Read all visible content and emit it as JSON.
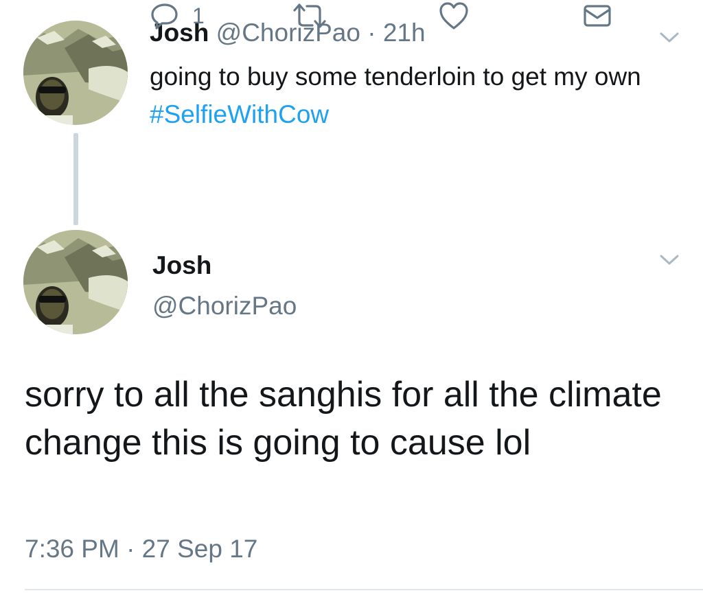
{
  "thread": {
    "parent_tweet": {
      "author_name": "Josh",
      "author_handle": "@ChorizPao",
      "separator": "·",
      "relative_time": "21h",
      "text_prefix": "going to buy some tenderloin to get my own ",
      "hashtag": "#SelfieWithCow",
      "reply_count": "1",
      "icons": [
        "chevron-down-icon",
        "reply-icon",
        "retweet-icon",
        "like-icon",
        "direct-message-icon"
      ]
    },
    "main_tweet": {
      "author_name": "Josh",
      "author_handle": "@ChorizPao",
      "text": "sorry to all the sanghis for all the climate change this is going to cause lol",
      "timestamp": "7:36 PM · 27 Sep 17",
      "icons": [
        "chevron-down-icon"
      ]
    }
  },
  "colors": {
    "text": "#14171a",
    "secondary": "#657786",
    "hashtag": "#1da1f2",
    "thread_line": "#ccd6dd",
    "icon": "#657786"
  }
}
